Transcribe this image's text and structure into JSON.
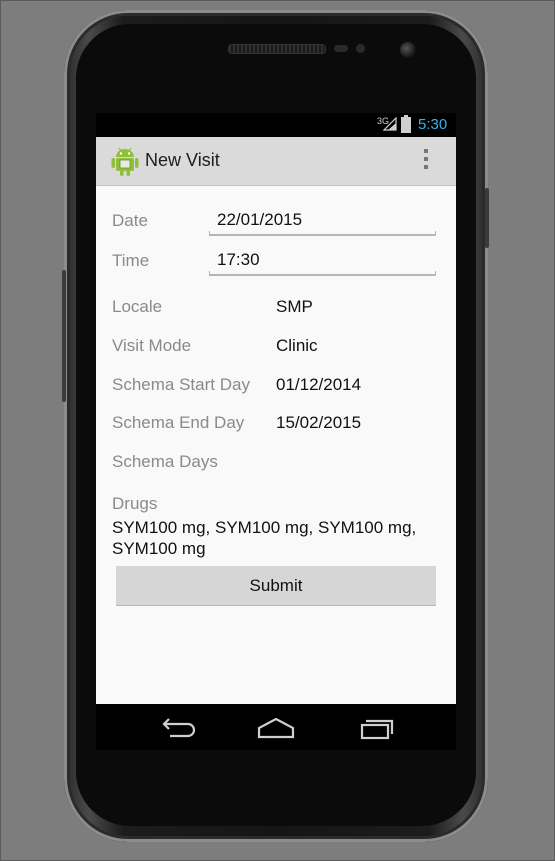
{
  "status_bar": {
    "network": "3G",
    "time": "5:30"
  },
  "action_bar": {
    "title": "New Visit",
    "app_icon": "android-icon",
    "overflow_icon": "overflow-menu-icon"
  },
  "form": {
    "date": {
      "label": "Date",
      "value": "22/01/2015"
    },
    "time": {
      "label": "Time",
      "value": "17:30"
    },
    "locale": {
      "label": "Locale",
      "value": "SMP"
    },
    "visit_mode": {
      "label": "Visit Mode",
      "value": "Clinic"
    },
    "schema_start_day": {
      "label": "Schema Start Day",
      "value": "01/12/2014"
    },
    "schema_end_day": {
      "label": "Schema End Day",
      "value": "15/02/2015"
    },
    "schema_days": {
      "label": "Schema Days",
      "value": ""
    },
    "drugs": {
      "label": "Drugs",
      "value": "SYM100 mg, SYM100 mg, SYM100 mg, SYM100 mg"
    },
    "submit_label": "Submit"
  },
  "nav_bar": {
    "back_icon": "back-icon",
    "home_icon": "home-icon",
    "recents_icon": "recent-apps-icon"
  },
  "colors": {
    "accent": "#33b5e5",
    "action_bar": "#dadada",
    "background": "#f9f9f9",
    "label": "#8a8a8a"
  }
}
